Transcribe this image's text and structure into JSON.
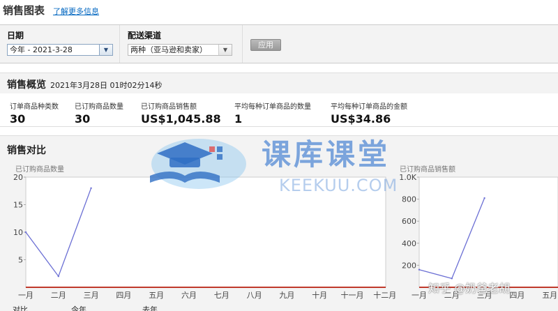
{
  "header": {
    "title": "销售图表",
    "link": "了解更多信息"
  },
  "filters": {
    "date_label": "日期",
    "date_value": "今年 - 2021-3-28",
    "channel_label": "配送渠道",
    "channel_value": "两种（亚马逊和卖家）",
    "apply_label": "应用"
  },
  "overview": {
    "title": "销售概览",
    "timestamp": "2021年3月28日 01时02分14秒",
    "metrics": [
      {
        "label": "订单商品种类数",
        "value": "30"
      },
      {
        "label": "已订购商品数量",
        "value": "30"
      },
      {
        "label": "已订购商品销售额",
        "value": "US$1,045.88"
      },
      {
        "label": "平均每种订单商品的数量",
        "value": "1"
      },
      {
        "label": "平均每种订单商品的金额",
        "value": "US$34.86"
      }
    ]
  },
  "comparison": {
    "title": "销售对比",
    "bottom_label": "对比",
    "legend_a": "今年",
    "legend_b": "去年"
  },
  "watermark": {
    "main": "课库课堂",
    "sub": "KEEKUU.COM",
    "zhihu": "知乎 @奶爸老胡"
  },
  "colors": {
    "line": "#6b6fd4",
    "baseline": "#c0392b",
    "link": "#0066c0"
  },
  "chart_data": [
    {
      "type": "line",
      "title": "已订购商品数量",
      "categories": [
        "一月",
        "二月",
        "三月",
        "四月",
        "五月",
        "六月",
        "七月",
        "八月",
        "九月",
        "十月",
        "十一月",
        "十二月"
      ],
      "y_ticks": [
        "20",
        "15",
        "10",
        "5"
      ],
      "ylim": [
        0,
        20
      ],
      "series": [
        {
          "values": [
            10,
            2,
            18
          ]
        }
      ]
    },
    {
      "type": "line",
      "title": "已订购商品销售额",
      "categories": [
        "一月",
        "二月",
        "三月",
        "四月",
        "五月"
      ],
      "y_ticks": [
        "1.0K",
        "800",
        "600",
        "400",
        "200"
      ],
      "ylim": [
        0,
        1000
      ],
      "series": [
        {
          "values": [
            160,
            80,
            810
          ]
        }
      ]
    }
  ]
}
